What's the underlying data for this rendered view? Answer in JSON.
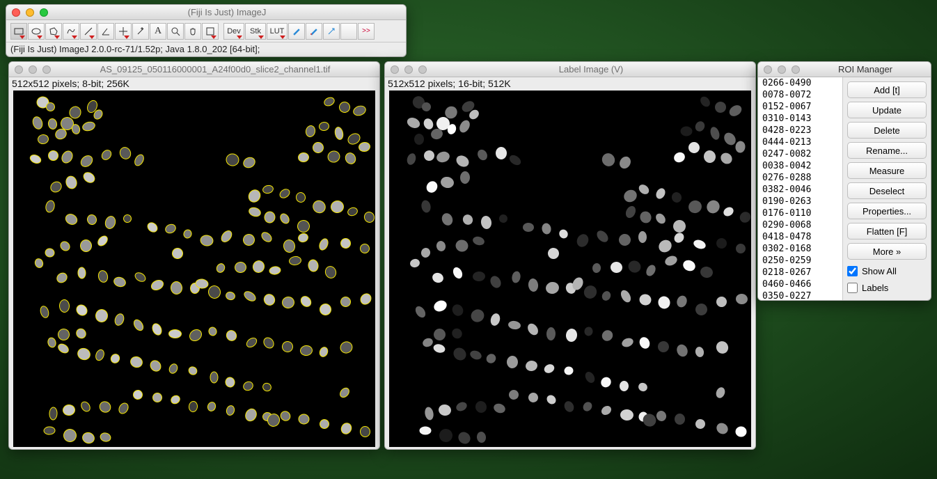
{
  "app": {
    "title": "(Fiji Is Just) ImageJ",
    "status": "(Fiji Is Just) ImageJ 2.0.0-rc-71/1.52p; Java 1.8.0_202 [64-bit];"
  },
  "toolbar": {
    "tools": [
      "rectangle",
      "oval",
      "polygon",
      "freehand",
      "line",
      "angle",
      "point",
      "wand",
      "text",
      "magnifier",
      "hand",
      "color-picker"
    ],
    "extra_labels": {
      "dev": "Dev",
      "stk": "Stk",
      "lut": "LUT",
      "arrows": ">>"
    }
  },
  "image1": {
    "title": "AS_09125_050116000001_A24f00d0_slice2_channel1.tif",
    "info": "512x512 pixels; 8-bit; 256K"
  },
  "image2": {
    "title": "Label Image (V)",
    "info": "512x512 pixels; 16-bit; 512K"
  },
  "roi": {
    "title": "ROI Manager",
    "items": [
      "0266-0490",
      "0078-0072",
      "0152-0067",
      "0310-0143",
      "0428-0223",
      "0444-0213",
      "0247-0082",
      "0038-0042",
      "0276-0288",
      "0382-0046",
      "0190-0263",
      "0176-0110",
      "0290-0068",
      "0418-0478",
      "0302-0168",
      "0250-0259",
      "0218-0267",
      "0460-0466",
      "0350-0227"
    ],
    "buttons": {
      "add": "Add [t]",
      "update": "Update",
      "delete": "Delete",
      "rename": "Rename...",
      "measure": "Measure",
      "deselect": "Deselect",
      "properties": "Properties...",
      "flatten": "Flatten [F]",
      "more": "More »"
    },
    "showall": "Show All",
    "labels": "Labels"
  },
  "cells": [
    [
      34,
      118
    ],
    [
      47,
      127
    ],
    [
      28,
      147
    ],
    [
      50,
      150
    ],
    [
      68,
      148
    ],
    [
      80,
      133
    ],
    [
      104,
      126
    ],
    [
      116,
      137
    ],
    [
      102,
      152
    ],
    [
      84,
      158
    ],
    [
      60,
      165
    ],
    [
      36,
      172
    ],
    [
      26,
      200
    ],
    [
      50,
      196
    ],
    [
      70,
      196
    ],
    [
      98,
      202
    ],
    [
      126,
      196
    ],
    [
      152,
      192
    ],
    [
      172,
      204
    ],
    [
      100,
      228
    ],
    [
      74,
      234
    ],
    [
      54,
      240
    ],
    [
      44,
      270
    ],
    [
      76,
      286
    ],
    [
      106,
      288
    ],
    [
      130,
      292
    ],
    [
      158,
      288
    ],
    [
      192,
      300
    ],
    [
      218,
      302
    ],
    [
      244,
      310
    ],
    [
      270,
      316
    ],
    [
      300,
      310
    ],
    [
      330,
      316
    ],
    [
      358,
      312
    ],
    [
      388,
      324
    ],
    [
      410,
      314
    ],
    [
      440,
      322
    ],
    [
      470,
      322
    ],
    [
      498,
      330
    ],
    [
      120,
      320
    ],
    [
      96,
      324
    ],
    [
      68,
      326
    ],
    [
      46,
      336
    ],
    [
      30,
      352
    ],
    [
      62,
      372
    ],
    [
      90,
      366
    ],
    [
      120,
      370
    ],
    [
      146,
      376
    ],
    [
      174,
      372
    ],
    [
      200,
      380
    ],
    [
      226,
      384
    ],
    [
      254,
      386
    ],
    [
      280,
      390
    ],
    [
      306,
      398
    ],
    [
      334,
      396
    ],
    [
      360,
      402
    ],
    [
      386,
      406
    ],
    [
      412,
      406
    ],
    [
      440,
      416
    ],
    [
      470,
      406
    ],
    [
      498,
      402
    ],
    [
      66,
      410
    ],
    [
      36,
      422
    ],
    [
      90,
      418
    ],
    [
      118,
      424
    ],
    [
      146,
      430
    ],
    [
      174,
      438
    ],
    [
      200,
      444
    ],
    [
      226,
      450
    ],
    [
      254,
      452
    ],
    [
      280,
      450
    ],
    [
      306,
      454
    ],
    [
      334,
      466
    ],
    [
      360,
      464
    ],
    [
      386,
      470
    ],
    [
      412,
      476
    ],
    [
      440,
      478
    ],
    [
      470,
      470
    ],
    [
      90,
      452
    ],
    [
      64,
      452
    ],
    [
      48,
      466
    ],
    [
      66,
      472
    ],
    [
      92,
      480
    ],
    [
      116,
      484
    ],
    [
      140,
      488
    ],
    [
      168,
      492
    ],
    [
      196,
      498
    ],
    [
      224,
      502
    ],
    [
      252,
      506
    ],
    [
      420,
      160
    ],
    [
      440,
      154
    ],
    [
      462,
      162
    ],
    [
      480,
      172
    ],
    [
      496,
      184
    ],
    [
      476,
      200
    ],
    [
      452,
      196
    ],
    [
      430,
      184
    ],
    [
      410,
      198
    ],
    [
      446,
      120
    ],
    [
      468,
      126
    ],
    [
      488,
      132
    ],
    [
      172,
      540
    ],
    [
      200,
      544
    ],
    [
      226,
      548
    ],
    [
      252,
      556
    ],
    [
      278,
      558
    ],
    [
      306,
      562
    ],
    [
      332,
      568
    ],
    [
      358,
      572
    ],
    [
      384,
      570
    ],
    [
      410,
      574
    ],
    [
      440,
      582
    ],
    [
      470,
      588
    ],
    [
      498,
      592
    ],
    [
      150,
      560
    ],
    [
      124,
      556
    ],
    [
      98,
      556
    ],
    [
      72,
      560
    ],
    [
      48,
      568
    ],
    [
      264,
      378
    ],
    [
      292,
      358
    ],
    [
      318,
      356
    ],
    [
      344,
      354
    ],
    [
      370,
      360
    ],
    [
      396,
      348
    ],
    [
      422,
      354
    ],
    [
      448,
      362
    ],
    [
      338,
      252
    ],
    [
      360,
      244
    ],
    [
      382,
      252
    ],
    [
      406,
      256
    ],
    [
      430,
      268
    ],
    [
      456,
      268
    ],
    [
      480,
      278
    ],
    [
      504,
      284
    ],
    [
      338,
      278
    ],
    [
      360,
      284
    ],
    [
      382,
      288
    ],
    [
      408,
      296
    ],
    [
      228,
      336
    ],
    [
      46,
      590
    ],
    [
      72,
      596
    ],
    [
      100,
      600
    ],
    [
      126,
      600
    ],
    [
      306,
      200
    ],
    [
      330,
      206
    ],
    [
      470,
      536
    ],
    [
      358,
      530
    ],
    [
      330,
      528
    ],
    [
      304,
      522
    ],
    [
      280,
      516
    ],
    [
      365,
      574
    ]
  ],
  "grays": [
    46,
    82,
    170,
    210,
    240,
    120,
    60,
    190,
    140,
    255,
    100,
    30,
    70,
    200,
    150,
    180,
    90,
    230,
    40,
    110,
    160,
    250,
    55,
    115,
    175,
    195,
    33,
    88,
    133,
    222,
    44,
    66,
    99,
    155,
    185,
    215,
    245,
    28,
    58,
    78,
    108,
    138,
    168,
    198,
    228,
    248,
    36,
    64,
    94,
    124,
    166,
    206
  ]
}
